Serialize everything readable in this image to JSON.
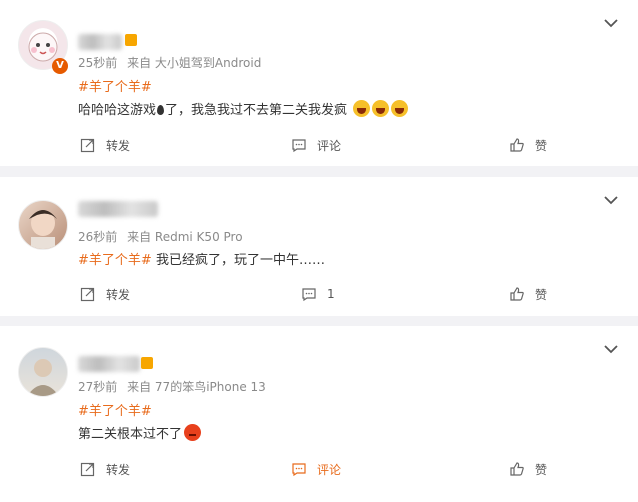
{
  "comments": [
    {
      "time": "25秒前",
      "source": "来自 大小姐驾到Android",
      "topic": "#羊了个羊#",
      "text_a": "哈哈哈这游戏",
      "text_b": "了，我急我过不去第二关我发疯",
      "repost": "转发",
      "comment": "评论",
      "like": "赞",
      "emoji": [
        "cry-laugh-emoji",
        "cry-laugh-emoji",
        "cry-laugh-emoji"
      ]
    },
    {
      "time": "26秒前",
      "source": "来自 Redmi K50 Pro",
      "topic": "#羊了个羊#",
      "text": "我已经疯了，玩了一中午……",
      "repost": "转发",
      "comment_count": "1",
      "like": "赞"
    },
    {
      "time": "27秒前",
      "source": "来自 77的笨鸟iPhone 13",
      "topic": "#羊了个羊#",
      "text": "第二关根本过不了",
      "repost": "转发",
      "comment": "评论",
      "like": "赞",
      "emoji": [
        "angry-emoji"
      ]
    }
  ],
  "colors": {
    "topic": "#e86b1c",
    "meta": "#8a8a8a",
    "background": "#f2f2f5"
  }
}
